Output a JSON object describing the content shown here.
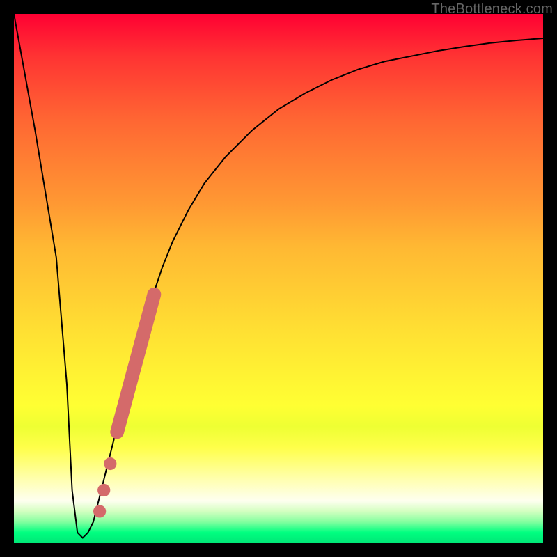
{
  "watermark": "TheBottleneck.com",
  "colors": {
    "curve_stroke": "#000000",
    "marker_fill": "#d46a6a",
    "frame_bg": "#000000"
  },
  "chart_data": {
    "type": "line",
    "title": "",
    "xlabel": "",
    "ylabel": "",
    "xlim": [
      0,
      100
    ],
    "ylim": [
      0,
      100
    ],
    "series": [
      {
        "name": "bottleneck-curve",
        "x": [
          0,
          2,
          4,
          6,
          8,
          10,
          11,
          12,
          13,
          14,
          15,
          16,
          18,
          20,
          22,
          24,
          26,
          28,
          30,
          33,
          36,
          40,
          45,
          50,
          55,
          60,
          65,
          70,
          75,
          80,
          85,
          90,
          95,
          100
        ],
        "y": [
          100,
          89,
          78,
          66,
          54,
          30,
          10,
          2,
          1,
          2,
          4,
          8,
          16,
          24,
          32,
          39,
          46,
          52,
          57,
          63,
          68,
          73,
          78,
          82,
          85,
          87.5,
          89.5,
          91,
          92,
          93,
          93.8,
          94.5,
          95,
          95.4
        ]
      }
    ],
    "markers": [
      {
        "name": "dot-1",
        "x": 16.2,
        "y": 6,
        "r": 1.2
      },
      {
        "name": "dot-2",
        "x": 17.0,
        "y": 10,
        "r": 1.2
      },
      {
        "name": "dot-3",
        "x": 18.2,
        "y": 15,
        "r": 1.2
      },
      {
        "name": "bar-segment",
        "x1": 19.5,
        "y1": 21,
        "x2": 26.5,
        "y2": 47,
        "width": 2.6
      }
    ]
  }
}
